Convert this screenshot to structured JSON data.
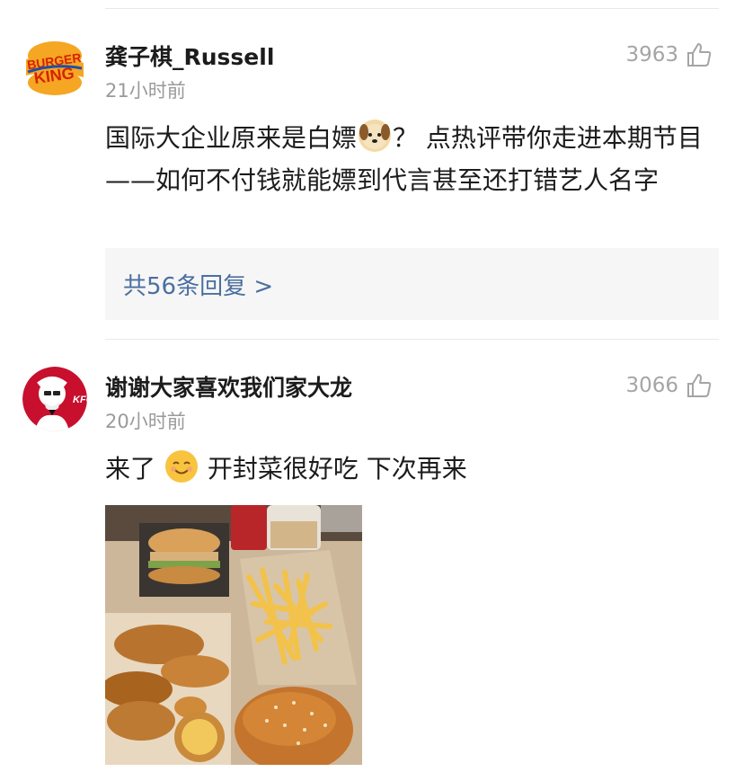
{
  "comments": [
    {
      "username": "龚子棋_Russell",
      "time": "21小时前",
      "likes": "3963",
      "avatar_icon": "burger-king-logo",
      "avatar_text": "BURGER KING",
      "text_before_emoji": "国际大企业原来是白嫖",
      "emoji": "dog-face-emoji",
      "text_after_emoji": "？ 点热评带你走进本期节目——如何不付钱就能嫖到代言甚至还打错艺人名字",
      "replies_label": "共56条回复 >"
    },
    {
      "username": "谢谢大家喜欢我们家大龙",
      "time": "20小时前",
      "likes": "3066",
      "avatar_icon": "kfc-logo",
      "avatar_text": "KFC",
      "text_before_emoji": "来了",
      "emoji": "smiling-face-emoji",
      "text_after_emoji": " 开封菜很好吃 下次再来",
      "image": "fast-food-meal-photo"
    }
  ],
  "colors": {
    "link": "#4a6fa0",
    "secondary_text": "#9a9a9a",
    "reply_bg": "#f6f6f6",
    "bk_red": "#d62300",
    "bk_orange": "#f5a623",
    "kfc_red": "#c8102e"
  }
}
